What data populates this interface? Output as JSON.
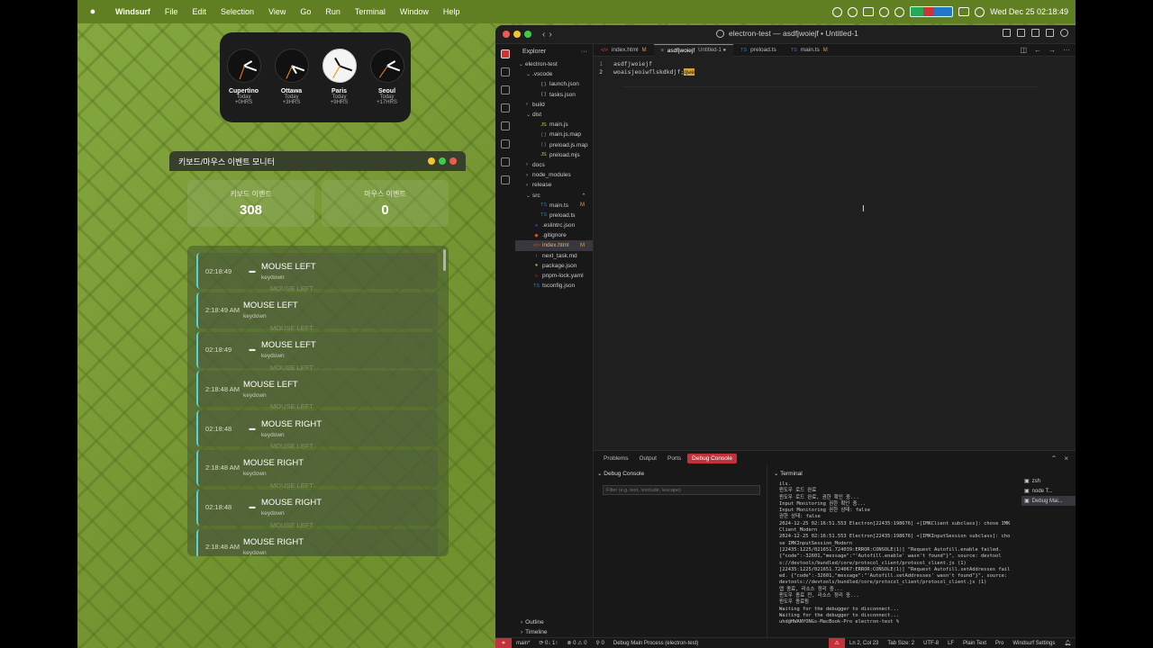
{
  "menubar": {
    "app_name": "Windsurf",
    "items": [
      "File",
      "Edit",
      "Selection",
      "View",
      "Go",
      "Run",
      "Terminal",
      "Window",
      "Help"
    ],
    "datetime": "Wed Dec 25  02:18:49"
  },
  "world_clock": [
    {
      "city": "Cupertino",
      "day": "Today",
      "offset": "+0HRS",
      "hour_deg": 60,
      "min_deg": 110
    },
    {
      "city": "Ottawa",
      "day": "Today",
      "offset": "+3HRS",
      "hour_deg": 150,
      "min_deg": 110
    },
    {
      "city": "Paris",
      "day": "Today",
      "offset": "+9HRS",
      "hour_deg": 330,
      "min_deg": 110
    },
    {
      "city": "Seoul",
      "day": "Today",
      "offset": "+17HRS",
      "hour_deg": 60,
      "min_deg": 110
    }
  ],
  "monitor": {
    "title": "키보드/마우스 이벤트 모니터",
    "keyboard_label": "키보드 이벤트",
    "keyboard_count": "308",
    "mouse_label": "마우스 이벤트",
    "mouse_count": "0",
    "ghost_text": "MOUSE LEFT",
    "events": [
      {
        "time": "02:18:49",
        "kbd": true,
        "title": "MOUSE LEFT",
        "sub": "keydown",
        "ghost": "MOUSE LEFT"
      },
      {
        "time": "2:18:49 AM",
        "kbd": false,
        "title": "MOUSE LEFT",
        "sub": "keydown",
        "ghost": "MOUSE LEFT"
      },
      {
        "time": "02:18:49",
        "kbd": true,
        "title": "MOUSE LEFT",
        "sub": "keydown",
        "ghost": "MOUSE LEFT"
      },
      {
        "time": "2:18:48 AM",
        "kbd": false,
        "title": "MOUSE LEFT",
        "sub": "keydown",
        "ghost": "MOUSE LEFT"
      },
      {
        "time": "02:18:48",
        "kbd": true,
        "title": "MOUSE RIGHT",
        "sub": "keydown",
        "ghost": "MOUSE LEFT"
      },
      {
        "time": "2:18:48 AM",
        "kbd": false,
        "title": "MOUSE RIGHT",
        "sub": "keydown",
        "ghost": "MOUSE LEFT"
      },
      {
        "time": "02:18:48",
        "kbd": true,
        "title": "MOUSE RIGHT",
        "sub": "keydown",
        "ghost": "MOUSE LEFT"
      },
      {
        "time": "2:18:48 AM",
        "kbd": false,
        "title": "MOUSE RIGHT",
        "sub": "keydown",
        "ghost": ""
      }
    ]
  },
  "ide": {
    "title": "electron-test — asdfjwoiejf • Untitled-1",
    "explorer_label": "Explorer",
    "tree": [
      {
        "depth": 0,
        "type": "folder-open",
        "name": "electron-test",
        "badge": ""
      },
      {
        "depth": 1,
        "type": "folder-open",
        "name": ".vscode",
        "badge": ""
      },
      {
        "depth": 2,
        "type": "json",
        "name": "launch.json",
        "badge": ""
      },
      {
        "depth": 2,
        "type": "json",
        "name": "tasks.json",
        "badge": ""
      },
      {
        "depth": 1,
        "type": "folder",
        "name": "build",
        "badge": ""
      },
      {
        "depth": 1,
        "type": "folder-open",
        "name": "dist",
        "badge": ""
      },
      {
        "depth": 2,
        "type": "js",
        "name": "main.js",
        "badge": ""
      },
      {
        "depth": 2,
        "type": "map",
        "name": "main.js.map",
        "badge": ""
      },
      {
        "depth": 2,
        "type": "map",
        "name": "preload.js.map",
        "badge": ""
      },
      {
        "depth": 2,
        "type": "js",
        "name": "preload.mjs",
        "badge": ""
      },
      {
        "depth": 1,
        "type": "folder",
        "name": "docs",
        "badge": ""
      },
      {
        "depth": 1,
        "type": "folder",
        "name": "node_modules",
        "badge": ""
      },
      {
        "depth": 1,
        "type": "folder",
        "name": "release",
        "badge": ""
      },
      {
        "depth": 1,
        "type": "folder-open",
        "name": "src",
        "badge": "•"
      },
      {
        "depth": 2,
        "type": "ts",
        "name": "main.ts",
        "badge": "M"
      },
      {
        "depth": 2,
        "type": "ts",
        "name": "preload.ts",
        "badge": ""
      },
      {
        "depth": 1,
        "type": "dot",
        "name": ".eslintrc.json",
        "badge": ""
      },
      {
        "depth": 1,
        "type": "git",
        "name": ".gitignore",
        "badge": ""
      },
      {
        "depth": 1,
        "type": "html",
        "name": "index.html",
        "badge": "M",
        "active": true
      },
      {
        "depth": 1,
        "type": "md",
        "name": "next_task.md",
        "badge": ""
      },
      {
        "depth": 1,
        "type": "pkg",
        "name": "package.json",
        "badge": ""
      },
      {
        "depth": 1,
        "type": "yaml",
        "name": "pnpm-lock.yaml",
        "badge": ""
      },
      {
        "depth": 1,
        "type": "tsjson",
        "name": "tsconfig.json",
        "badge": ""
      }
    ],
    "outline_label": "Outline",
    "timeline_label": "Timeline",
    "tabs": [
      {
        "icon": "</>",
        "name": "index.html",
        "mod": "M",
        "active": false
      },
      {
        "icon": "≡",
        "name": "asdfjwoiejf",
        "mod": "Untitled-1 ●",
        "active": true
      },
      {
        "icon": "TS",
        "name": "preload.ts",
        "mod": "",
        "active": false
      },
      {
        "icon": "TS",
        "name": "main.ts",
        "mod": "M",
        "active": false
      }
    ],
    "code": [
      {
        "n": "1",
        "text": "asdfjwoiejf",
        "hl": ""
      },
      {
        "n": "2",
        "text": "woaisjeoiwflskdkdjf;",
        "hl": "qwe"
      }
    ],
    "panel_tabs": [
      "Problems",
      "Output",
      "Ports",
      "Debug Console"
    ],
    "debug_console_label": "Debug Console",
    "filter_placeholder": "Filter (e.g. text, !exclude, \\escape)",
    "terminal_label": "Terminal",
    "terminal_text": "ils.\n윈도우 로드 완료\n윈도우 로드 완료, 권한 확인 중...\nInput Monitoring 권한 확인 중...\nInput Monitoring 권한 상태: false\n권한 상태: false\n2024-12-25 02:16:51.553 Electron[22435:198676] +[IMKClient subclass]: chose IMKClient_Modern\n2024-12-25 02:16:51.553 Electron[22435:198676] +[IMKInputSession subclass]: chose IMKInputSession_Modern\n[22435:1225/021651.724039:ERROR:CONSOLE(1)] \"Request Autofill.enable failed. {\"code\":-32601,\"message\":\"'Autofill.enable' wasn't found\"}\", source: devtools://devtools/bundled/core/protocol_client/protocol_client.js (1)\n[22435:1225/021651.724067:ERROR:CONSOLE(1)] \"Request Autofill.setAddresses failed. {\"code\":-32601,\"message\":\"'Autofill.setAddresses' wasn't found\"}\", source: devtools://devtools/bundled/core/protocol_client/protocol_client.js (1)\n앱 종료, 리소스 정리 중...\n윈도우 종료 전, 리소스 정리 중...\n윈도우 종료됨\nWaiting for the debugger to disconnect...\nWaiting for the debugger to disconnect...\nuhd@HWANYONGs-MacBook-Pro electron-test %",
    "term_sessions": [
      {
        "name": "zsh",
        "active": false
      },
      {
        "name": "node T...",
        "active": false
      },
      {
        "name": "Debug Mai...",
        "active": true
      }
    ],
    "status": {
      "branch": "main*",
      "sync": "⟳ 0↓ 1↑",
      "problems": "⊗ 0 ⚠ 0",
      "ports": "⚲ 0",
      "debug": "Debug Main Process (electron-test)",
      "position": "Ln 2, Col 23",
      "tab_size": "Tab Size: 2",
      "encoding": "UTF-8",
      "eol": "LF",
      "language": "Plain Text",
      "plan": "Pro",
      "settings": "Windsurf Settings"
    }
  }
}
